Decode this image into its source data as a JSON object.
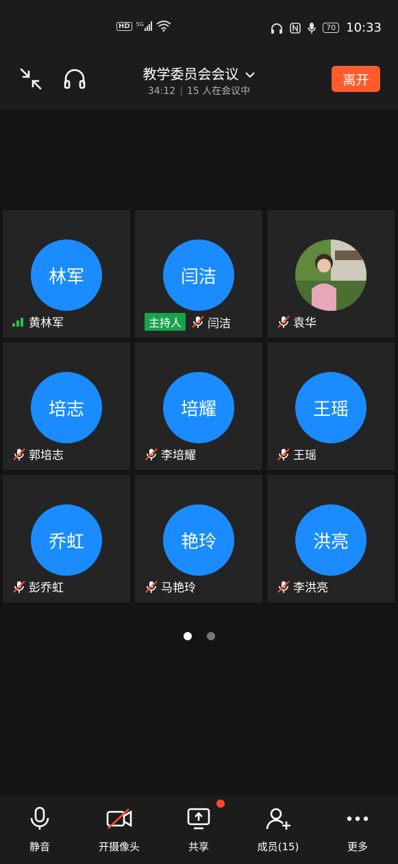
{
  "status_bar": {
    "hd_label": "HD",
    "network_label": "5G",
    "battery": "70",
    "time": "10:33"
  },
  "header": {
    "title": "教学委员会会议",
    "elapsed": "34:12",
    "participants_text": "15 人在会议中",
    "leave_label": "离开"
  },
  "tiles": [
    {
      "avatar_text": "林军",
      "name": "黄林军",
      "status": "signal"
    },
    {
      "avatar_text": "闫洁",
      "name": "闫洁",
      "status": "muted",
      "host_tag": "主持人"
    },
    {
      "avatar_text": "",
      "name": "袁华",
      "status": "muted",
      "photo": true
    },
    {
      "avatar_text": "培志",
      "name": "郭培志",
      "status": "muted"
    },
    {
      "avatar_text": "培耀",
      "name": "李培耀",
      "status": "muted"
    },
    {
      "avatar_text": "王瑶",
      "name": "王瑶",
      "status": "muted"
    },
    {
      "avatar_text": "乔虹",
      "name": "彭乔虹",
      "status": "muted"
    },
    {
      "avatar_text": "艳玲",
      "name": "马艳玲",
      "status": "muted"
    },
    {
      "avatar_text": "洪亮",
      "name": "李洪亮",
      "status": "muted"
    }
  ],
  "pager": {
    "pages": 2,
    "current": 1
  },
  "toolbar": {
    "mute_label": "静音",
    "camera_label": "开摄像头",
    "share_label": "共享",
    "members_label": "成员(15)",
    "more_label": "更多"
  },
  "colors": {
    "accent_blue": "#1a8cff",
    "leave_orange": "#ff5b2d",
    "host_green": "#18a24c",
    "muted_red": "#ff4b2b"
  }
}
